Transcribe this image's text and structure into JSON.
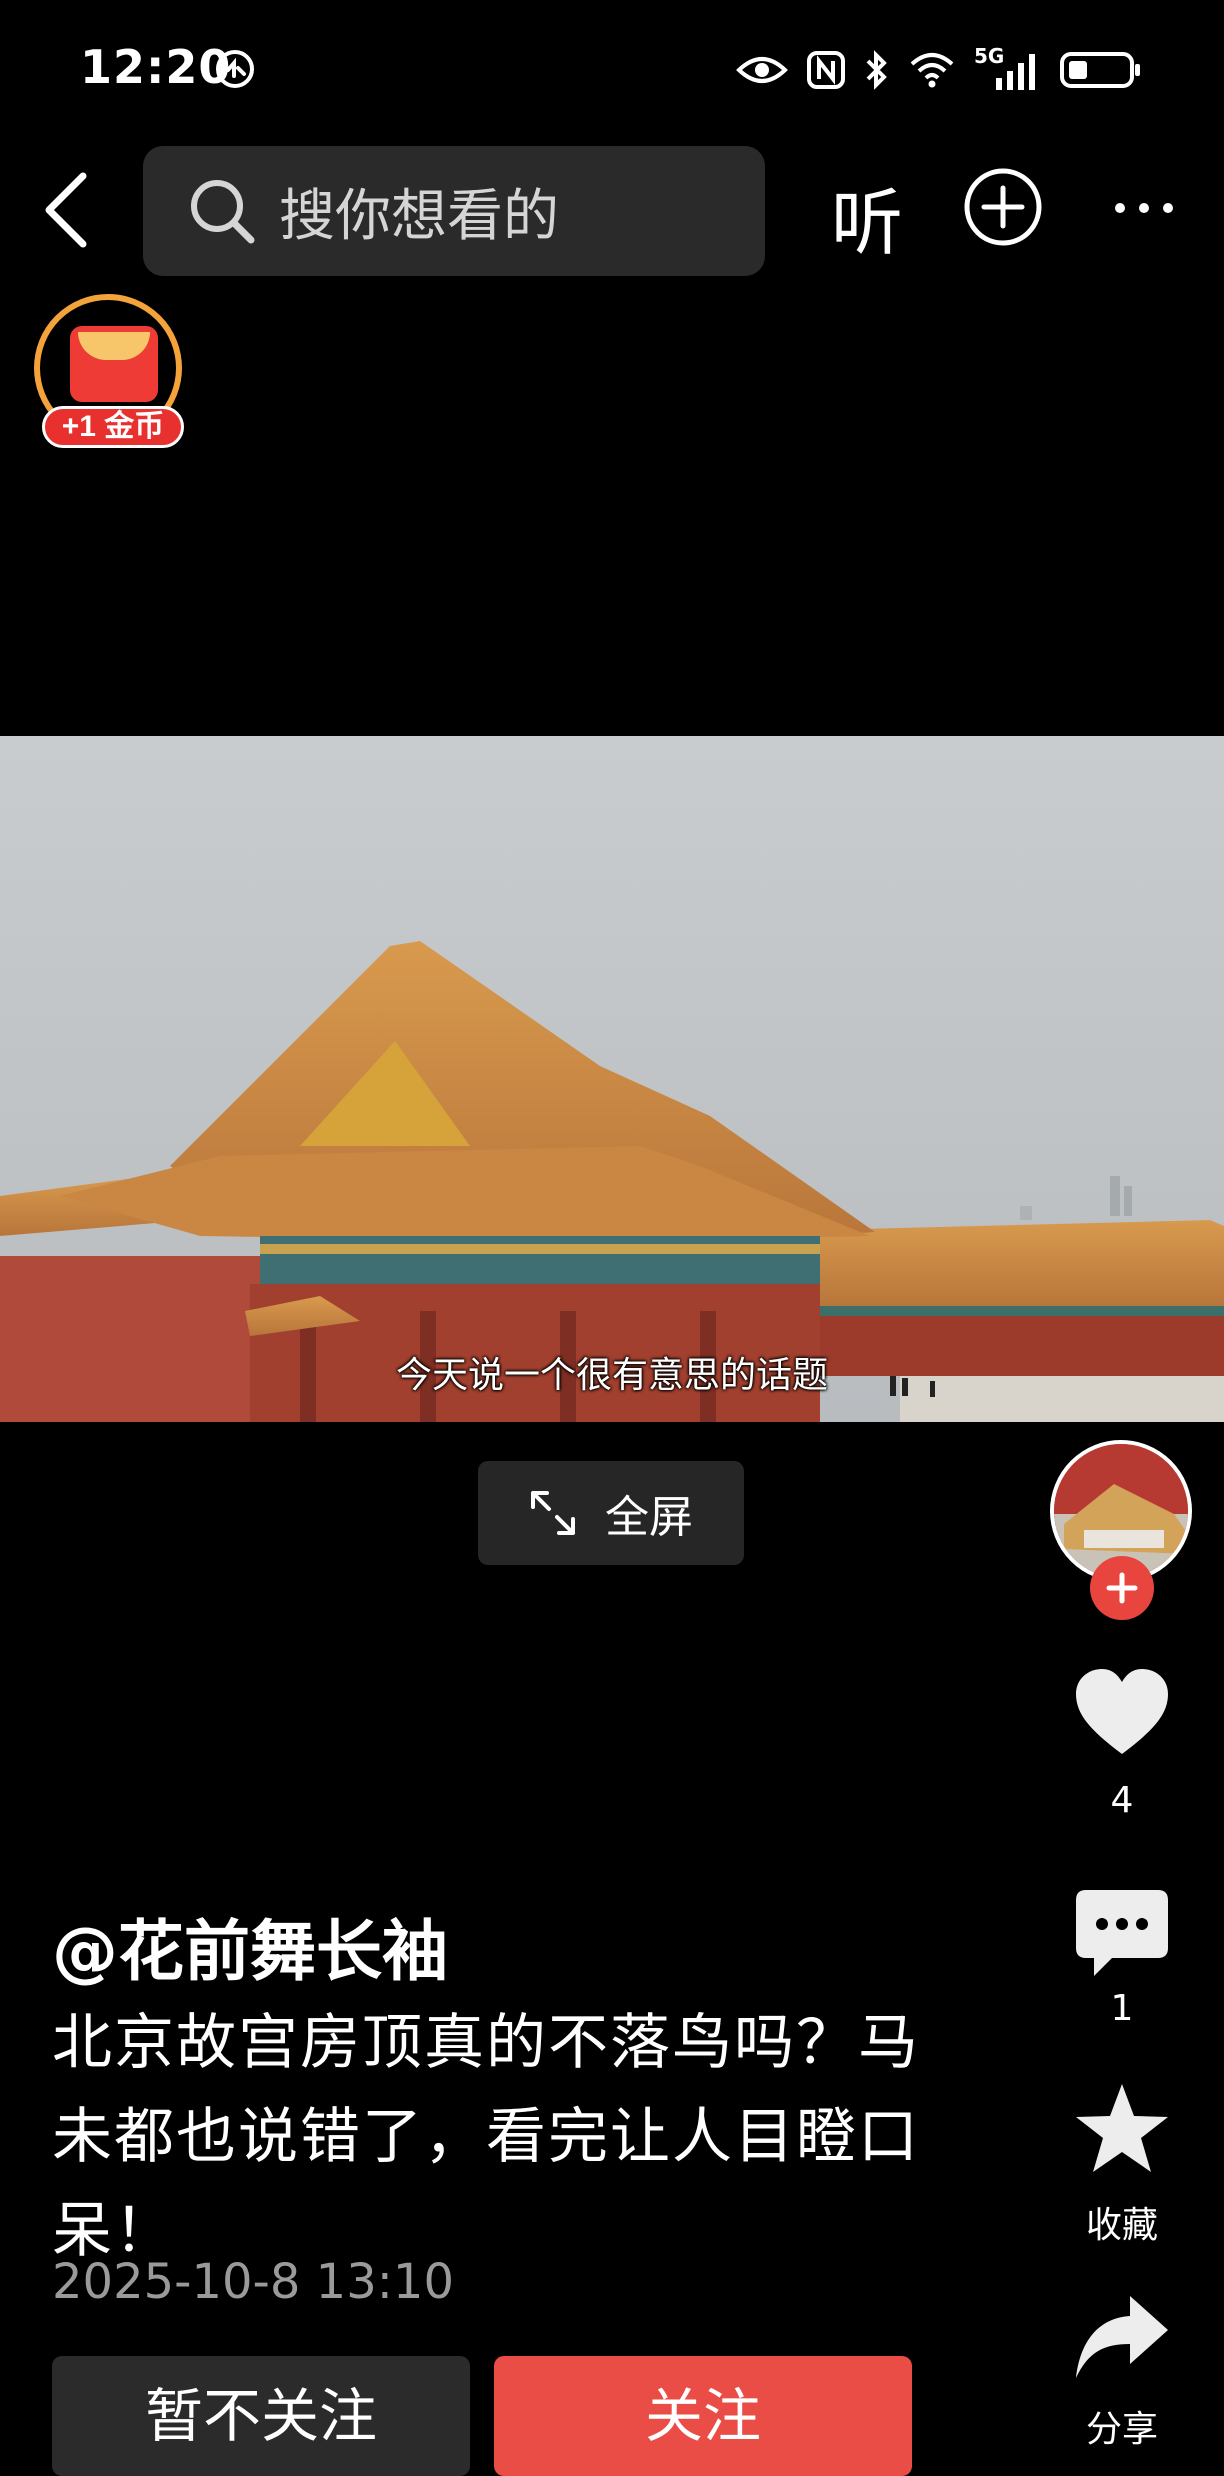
{
  "status_bar": {
    "time": "12:20",
    "network": "5G"
  },
  "top_nav": {
    "search_placeholder": "搜你想看的",
    "listen_label": "听"
  },
  "coin_badge": {
    "label": "+1 金币"
  },
  "video": {
    "subtitle": "今天说一个很有意思的话题",
    "fullscreen_label": "全屏"
  },
  "side_actions": {
    "like_count": "4",
    "comment_count": "1",
    "favorite_label": "收藏",
    "share_label": "分享"
  },
  "post": {
    "author": "@花前舞长袖",
    "description_lines": [
      "北京故宫房顶真的不落鸟吗？马",
      "未都也说错了，看完让人目瞪口",
      "呆！"
    ],
    "timestamp": "2025-10-8 13:10"
  },
  "actions": {
    "unfollow_label": "暂不关注",
    "follow_label": "关注"
  },
  "colors": {
    "follow_red": "#ea4c46",
    "coin_ring": "#f4a23a",
    "background": "#000000"
  }
}
